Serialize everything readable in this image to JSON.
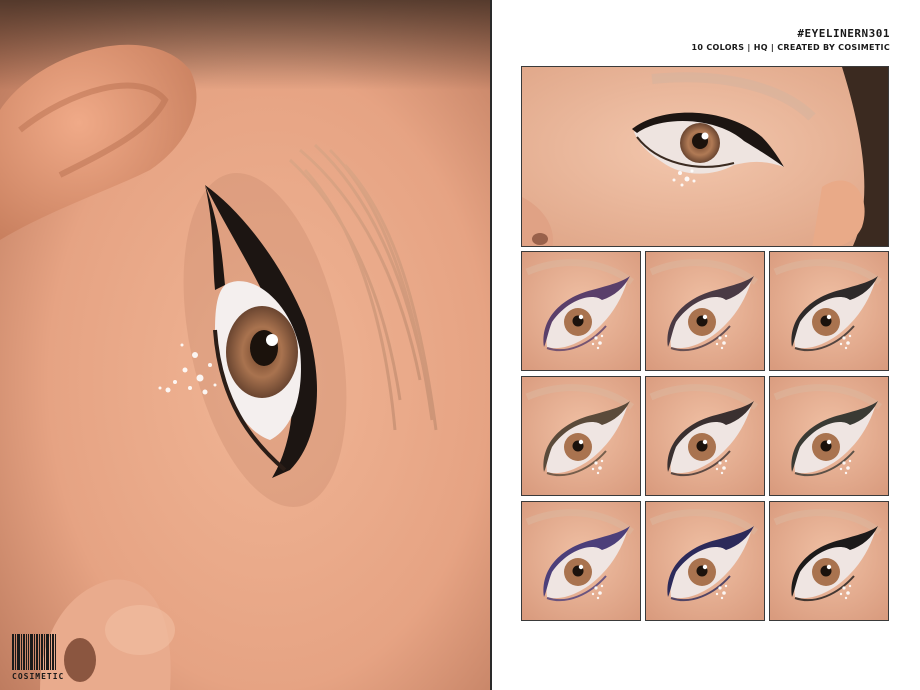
{
  "brand": {
    "name": "COSIMETIC"
  },
  "header": {
    "title": "#EYELINERN301",
    "subtitle": "10 COLORS | HQ | CREATED BY COSIMETIC"
  },
  "colors": {
    "background": "#ffffff",
    "skin": "#e7a98a",
    "iris": "#a9734f",
    "text": "#1a1a1a"
  },
  "swatches": [
    {
      "liner": "#5a3f6a"
    },
    {
      "liner": "#4a3a44"
    },
    {
      "liner": "#2e2a2a"
    },
    {
      "liner": "#5a4a3a"
    },
    {
      "liner": "#3a3030"
    },
    {
      "liner": "#3a3a34"
    },
    {
      "liner": "#4c3f7a"
    },
    {
      "liner": "#2c2a5a"
    },
    {
      "liner": "#1c1a1a"
    }
  ]
}
